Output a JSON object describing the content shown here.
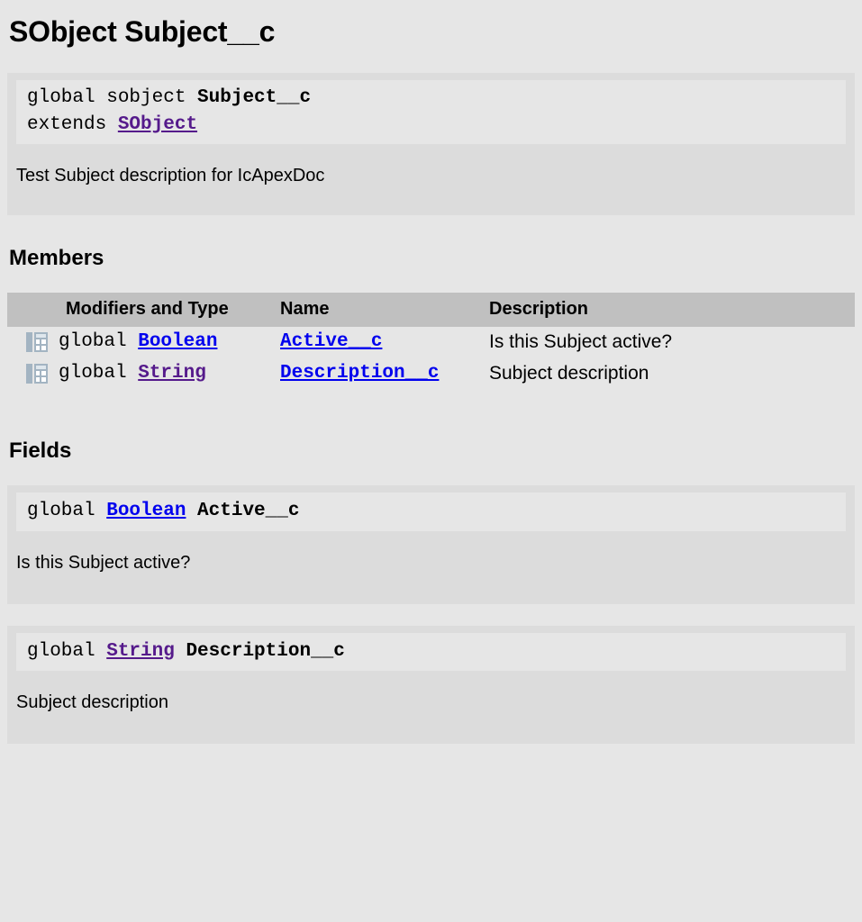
{
  "page": {
    "title": "SObject Subject__c",
    "background_color": "#e6e6e6",
    "block_color": "#dcdcdc",
    "code_color": "#e6e6e6",
    "table_header_color": "#c0c0c0",
    "link_color": "#0000ee",
    "visited_link_color": "#551a8b"
  },
  "declaration": {
    "line1_prefix": "global sobject ",
    "line1_name": "Subject__c",
    "line2_prefix": "extends ",
    "line2_link": "SObject",
    "description": "Test Subject description for IcApexDoc"
  },
  "members": {
    "heading": "Members",
    "columns": [
      "",
      "Modifiers and Type",
      "Name",
      "Description"
    ],
    "rows": [
      {
        "icon": "table-field-icon",
        "modifier": "global ",
        "type": "Boolean",
        "type_link_state": "new",
        "name": "Active__c",
        "description": "Is this Subject active?"
      },
      {
        "icon": "table-field-icon",
        "modifier": "global ",
        "type": "String",
        "type_link_state": "visited",
        "name": "Description__c",
        "description": "Subject description"
      }
    ]
  },
  "fields": {
    "heading": "Fields",
    "items": [
      {
        "signature_prefix": "global ",
        "signature_type": "Boolean",
        "signature_type_link_state": "new",
        "signature_name": " Active__c",
        "description": "Is this Subject active?"
      },
      {
        "signature_prefix": "global ",
        "signature_type": "String",
        "signature_type_link_state": "visited",
        "signature_name": " Description__c",
        "description": "Subject description"
      }
    ]
  }
}
